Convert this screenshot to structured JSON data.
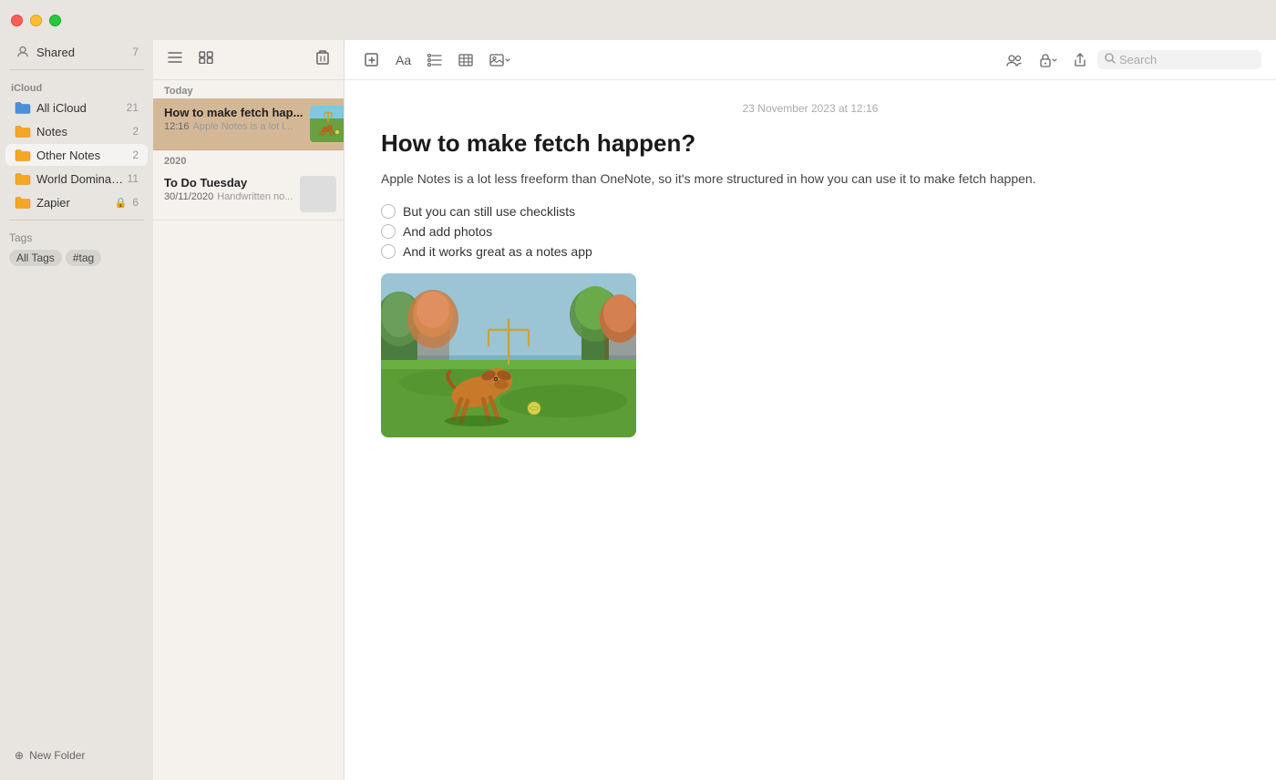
{
  "titlebar": {
    "traffic_lights": [
      "red",
      "yellow",
      "green"
    ]
  },
  "sidebar": {
    "shared_label": "Shared",
    "shared_count": "7",
    "icloud_label": "iCloud",
    "items": [
      {
        "id": "all-icloud",
        "name": "All iCloud",
        "count": "21",
        "icon": "folder-blue"
      },
      {
        "id": "notes",
        "name": "Notes",
        "count": "2",
        "icon": "folder-yellow"
      },
      {
        "id": "other-notes",
        "name": "Other Notes",
        "count": "2",
        "icon": "folder-yellow",
        "active": true
      },
      {
        "id": "world-domination",
        "name": "World Domination Pla.",
        "count": "11",
        "icon": "folder-yellow"
      },
      {
        "id": "zapier",
        "name": "Zapier",
        "count": "6",
        "icon": "folder-yellow",
        "lock": true
      }
    ],
    "tags_label": "Tags",
    "tags": [
      "All Tags",
      "#tag"
    ],
    "new_folder_label": "New Folder"
  },
  "notes_list": {
    "today_label": "Today",
    "year_label": "2020",
    "notes": [
      {
        "id": "fetch",
        "title": "How to make fetch hap...",
        "time": "12:16",
        "preview": "Apple Notes is a lot l...",
        "has_thumbnail": true,
        "active": true
      },
      {
        "id": "todo",
        "title": "To Do Tuesday",
        "date": "30/11/2020",
        "preview": "Handwritten no...",
        "has_thumbnail": true,
        "active": false
      }
    ]
  },
  "editor": {
    "timestamp": "23 November 2023 at 12:16",
    "title": "How to make fetch happen?",
    "body": "Apple Notes is a lot less freeform than OneNote, so it's more structured in how you can use it to make fetch happen.",
    "checklist": [
      "But you can still use checklists",
      "And add photos",
      "And it works great as a notes app"
    ],
    "toolbar": {
      "font_btn": "Aa",
      "checklist_btn": "≡",
      "table_btn": "⊞",
      "media_btn": "⊡",
      "collab_btn": "👥",
      "lock_btn": "🔒",
      "share_btn": "⬆",
      "search_placeholder": "Search",
      "new_note_btn": "✏",
      "trash_btn": "🗑",
      "list_view_btn": "☰",
      "grid_view_btn": "⊞"
    }
  }
}
